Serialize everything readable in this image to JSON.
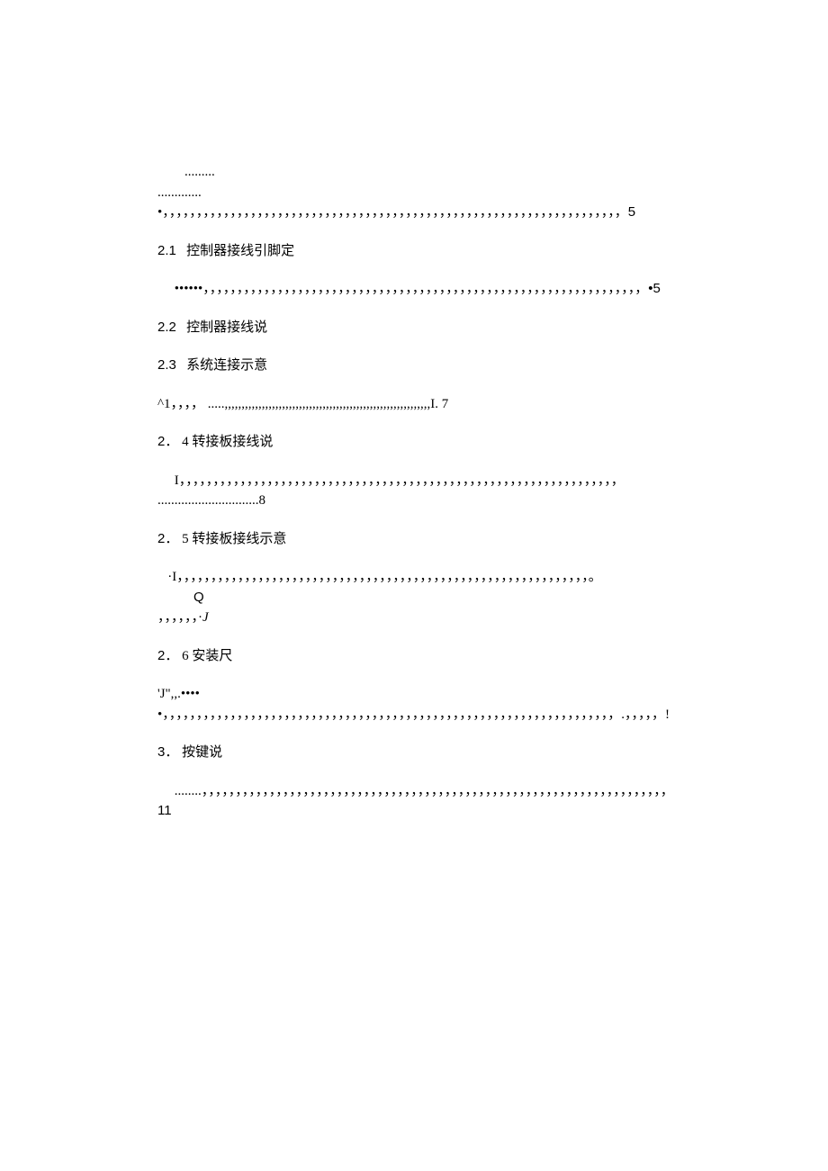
{
  "toc": {
    "entry0_dots_a": ".........",
    "entry0_dots_b": ".............•，，，，，，，，，，，，，，，，，，，，，，，，，，，，，，，，，，，，，，，，，，，，，，，，，，，，，，，，，，，，，，，，，，，，",
    "entry0_page": "5",
    "h21_num": "2.1",
    "h21_title": "控制器接线引脚定",
    "entry21_dots": "••••••，，，，，，，，，，，，，，，，，，，，，，，，，，，，，，，，，，，，，，，，，，，，，，，，，，，，，，，，，，，，，，，，，",
    "entry21_page": "•5",
    "h22_num": "2.2",
    "h22_title": "控制器接线说",
    "h23_num": "2.3",
    "h23_title": "系统连接示意",
    "entry23_line": "^1，，，，   .....,,,,,,,,,,,,,,,,,,,,,,,,,,,,,,,,,,,,,,,,,,,,,,,,,,,,,,,,,,,,,I.  7",
    "h24_num": "2．",
    "h24_title": "4 转接板接线说",
    "entry24_dots": "I，，，，，，，，，，，，，，，，，，，，，，，，，，，，，，，，，，，，，，，，，，，，，，，，，，，，，，，，，，，，，，，，， ..............................8",
    "h25_num": "2．",
    "h25_title": "5 转接板接线示意",
    "entry25_dots_a": "·I，，，，，，，，，，，，，，，，，，，，，，，，，，，，，，，，，，，，，，，，，，，，，，，，，，，，，，，，，，，，，。",
    "entry25_q": "Q",
    "entry25_j_prefix": "，，，，，，·",
    "entry25_j": "J",
    "h26_num": "2．",
    "h26_title": "6 安装尺",
    "entry26_dots": "'J\",,.•••••，，，，，，，，，，，，，，，，，，，，，，，，，，，，，，，，，，，，，，，，，，，，，，，，，，，，，，，，，，，，，，，，，，，.，，，，，!",
    "h3_num": "3．",
    "h3_title": "按键说",
    "entry3_dots": "........，，，，，，，，，，，，，，，，，，，，，，，，，，，，，，，，，，，，，，，，，，，，，，，，，，，，，，，，，，，，，，，，，，，，，",
    "entry3_page": "11"
  }
}
